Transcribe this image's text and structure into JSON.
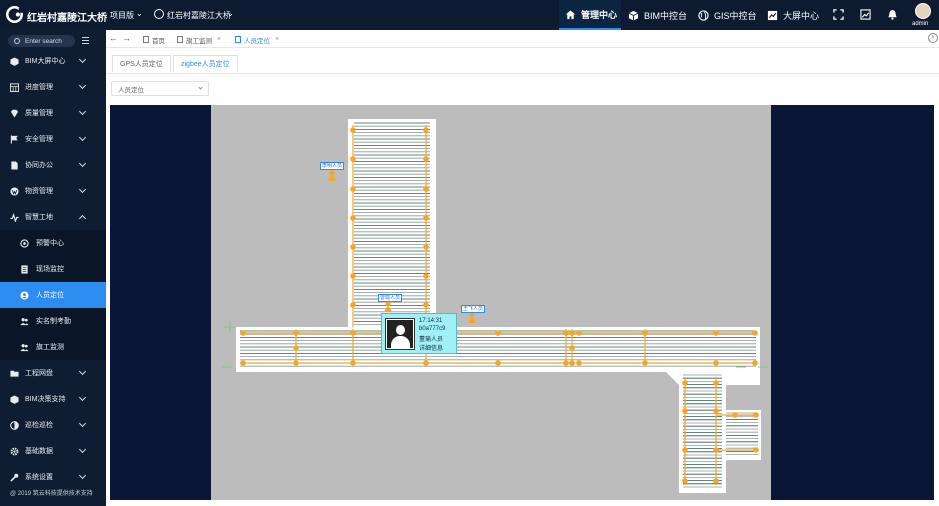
{
  "header": {
    "app_title": "红岩村嘉陵江大桥",
    "project_version": "项目版",
    "project_name": "红岩村嘉陵江大桥",
    "nav": [
      {
        "label": "管理中心",
        "icon": "home-icon",
        "active": true
      },
      {
        "label": "BIM中控台",
        "icon": "cube-icon"
      },
      {
        "label": "GIS中控台",
        "icon": "globe-icon"
      },
      {
        "label": "大屏中心",
        "icon": "chart-screen-icon"
      }
    ],
    "user": "admin"
  },
  "sidebar": {
    "search_placeholder": "Enter search",
    "items": [
      {
        "label": "BIM大屏中心",
        "icon": "cube-icon"
      },
      {
        "label": "进度管理",
        "icon": "calendar-icon"
      },
      {
        "label": "质量管理",
        "icon": "diamond-icon"
      },
      {
        "label": "安全管理",
        "icon": "flag-icon"
      },
      {
        "label": "协同办公",
        "icon": "document-icon"
      },
      {
        "label": "物资管理",
        "icon": "wordpress-icon"
      },
      {
        "label": "智慧工地",
        "icon": "pulse-icon",
        "expanded": true
      }
    ],
    "sub_items": [
      {
        "label": "预警中心",
        "icon": "target-icon"
      },
      {
        "label": "现场监控",
        "icon": "list-icon"
      },
      {
        "label": "人员定位",
        "icon": "user-circle-icon",
        "active": true
      },
      {
        "label": "实名制考勤",
        "icon": "group-icon"
      },
      {
        "label": "旗工监测",
        "icon": "group-icon"
      }
    ],
    "items_after": [
      {
        "label": "工程网盘",
        "icon": "folder-icon"
      },
      {
        "label": "BIM决策支持",
        "icon": "cube-icon"
      },
      {
        "label": "巡检巡检",
        "icon": "half-circle-icon"
      },
      {
        "label": "基础数据",
        "icon": "gear-icon"
      },
      {
        "label": "系统设置",
        "icon": "wrench-icon"
      }
    ],
    "copyright": "@ 2019 筑云科技提供技术支持"
  },
  "tabs": [
    {
      "label": "首页",
      "closable": false
    },
    {
      "label": "旗工监测",
      "closable": true
    },
    {
      "label": "人员定位",
      "closable": true,
      "active": true
    }
  ],
  "subtabs": [
    {
      "label": "GPS人员定位"
    },
    {
      "label": "zigbee人员定位",
      "active": true
    }
  ],
  "filter": {
    "value": "人员定位"
  },
  "map": {
    "markers": [
      {
        "label": "李明人员"
      },
      {
        "label": "曾瑜人员"
      },
      {
        "label": "王飞人员"
      }
    ],
    "popup": {
      "time": "17:14:31",
      "id": "b0a777c9",
      "name": "董瑜人员",
      "link": "详细信息"
    }
  },
  "colors": {
    "accent": "#2d8cf0",
    "sidebar_bg": "#0f1d32",
    "topbar_bg": "#0d1a30",
    "map_bg": "#091638",
    "marker": "#f5a623"
  }
}
